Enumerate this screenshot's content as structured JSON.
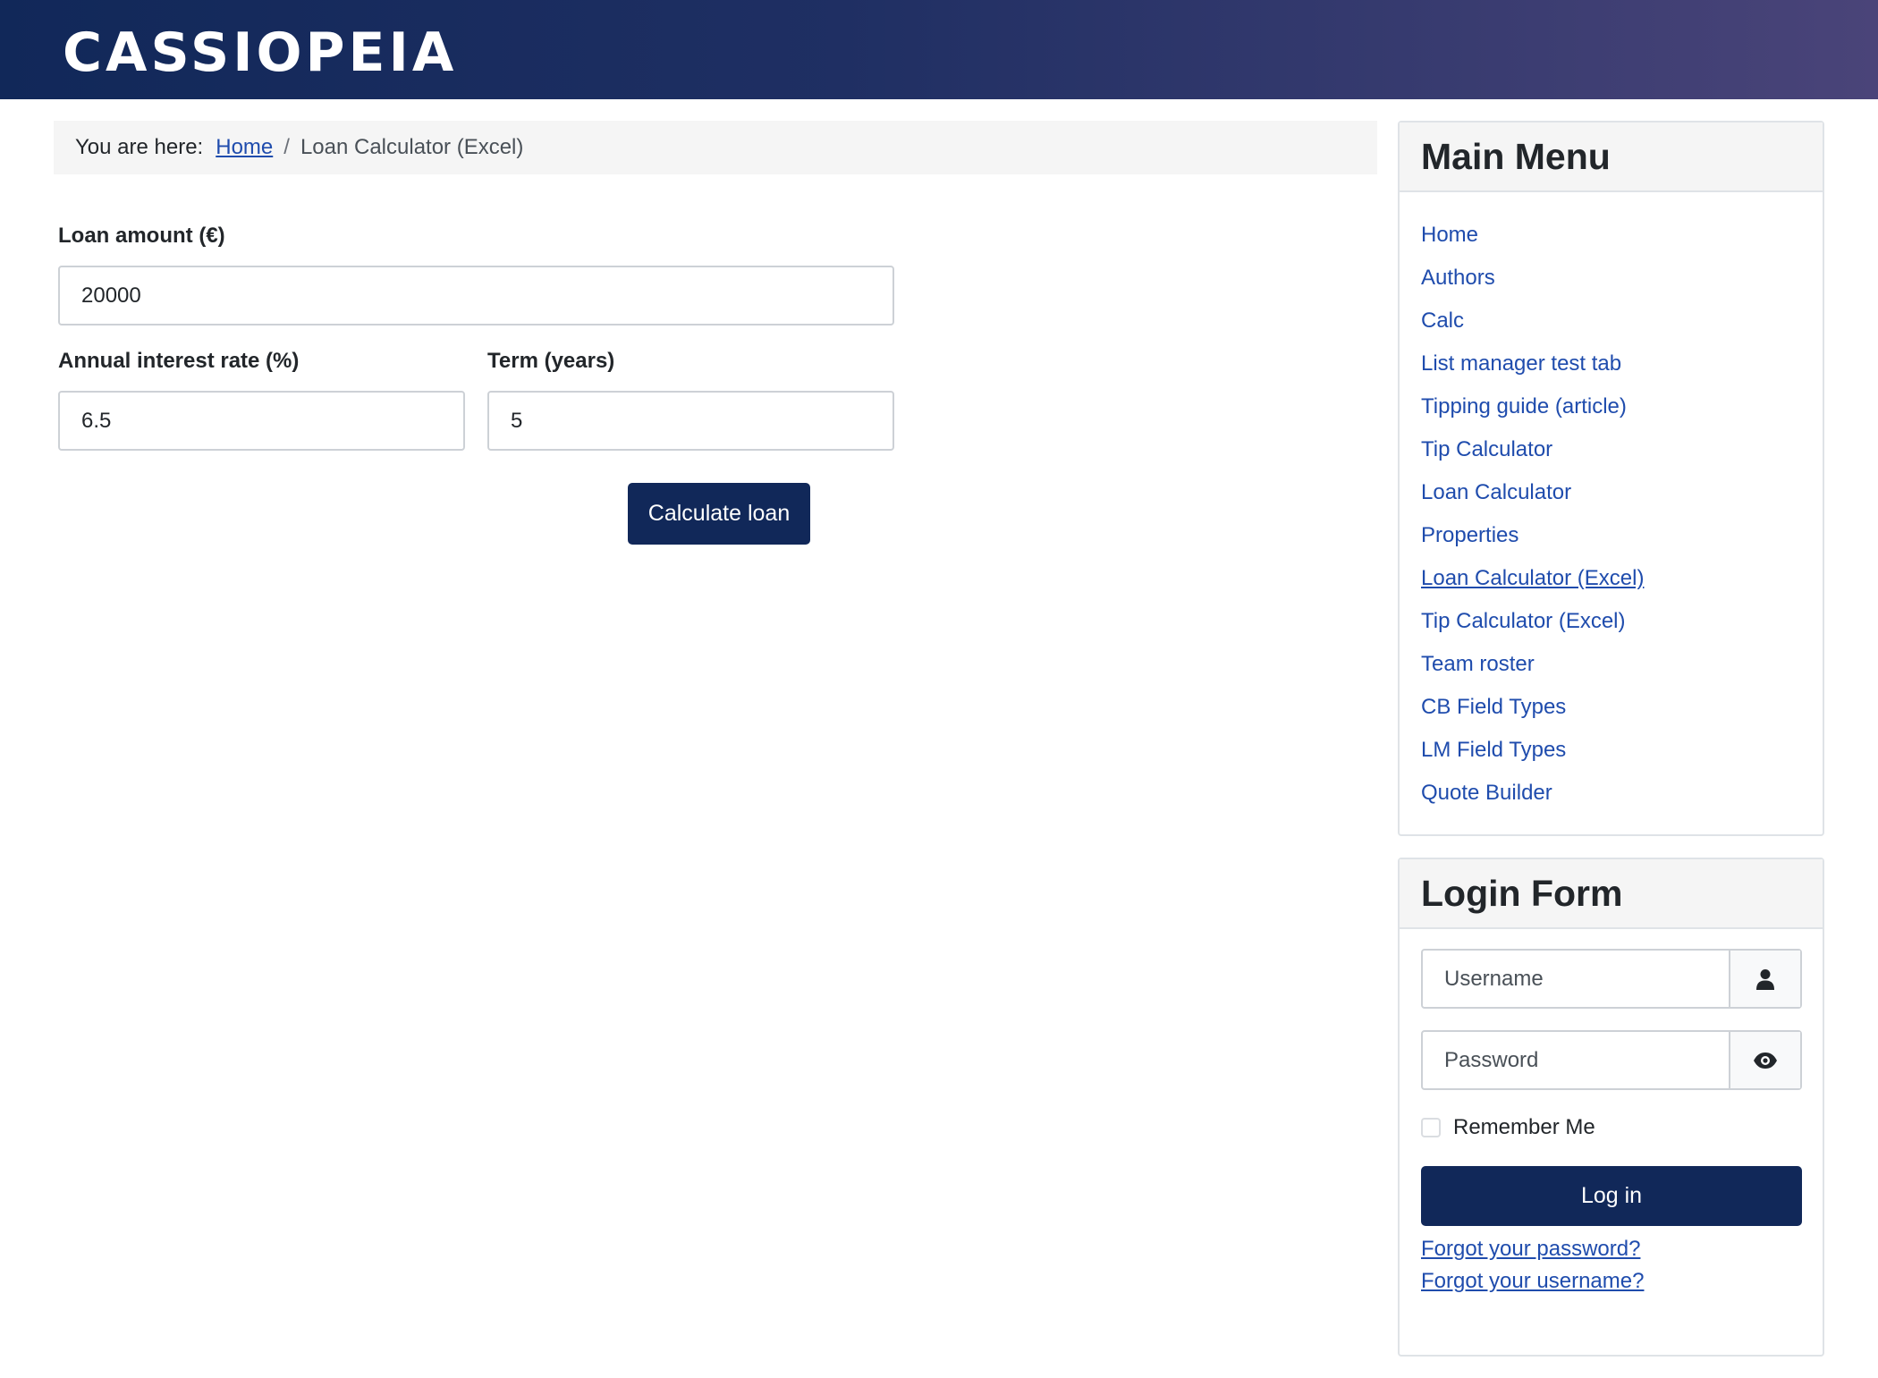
{
  "header": {
    "brand": "CASSIOPEIA"
  },
  "breadcrumb": {
    "prefix": "You are here:",
    "home": "Home",
    "separator": "/",
    "current": "Loan Calculator (Excel)"
  },
  "form": {
    "loan_amount": {
      "label": "Loan amount (€)",
      "value": "20000"
    },
    "interest_rate": {
      "label": "Annual interest rate (%)",
      "value": "6.5"
    },
    "term": {
      "label": "Term (years)",
      "value": "5"
    },
    "submit_label": "Calculate loan"
  },
  "main_menu": {
    "title": "Main Menu",
    "items": [
      {
        "label": "Home"
      },
      {
        "label": "Authors"
      },
      {
        "label": "Calc"
      },
      {
        "label": "List manager test tab"
      },
      {
        "label": "Tipping guide (article)"
      },
      {
        "label": "Tip Calculator"
      },
      {
        "label": "Loan Calculator"
      },
      {
        "label": "Properties"
      },
      {
        "label": "Loan Calculator (Excel)",
        "active": true
      },
      {
        "label": "Tip Calculator (Excel)"
      },
      {
        "label": "Team roster"
      },
      {
        "label": "CB Field Types"
      },
      {
        "label": "LM Field Types"
      },
      {
        "label": "Quote Builder"
      }
    ]
  },
  "login": {
    "title": "Login Form",
    "username_placeholder": "Username",
    "username_icon": "user-icon",
    "password_placeholder": "Password",
    "password_icon": "eye-icon",
    "remember_label": "Remember Me",
    "remember_checked": false,
    "submit_label": "Log in",
    "forgot_password": "Forgot your password?",
    "forgot_username": "Forgot your username?"
  },
  "colors": {
    "header_start": "#112859",
    "header_end": "#4a4479",
    "primary": "#112859",
    "link": "#1f4cad"
  }
}
